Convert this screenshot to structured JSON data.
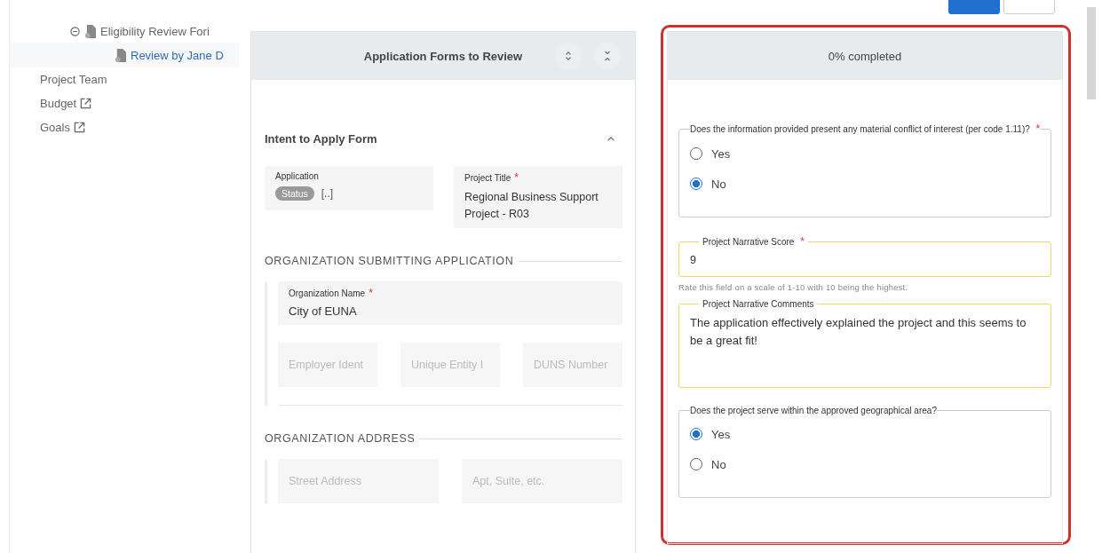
{
  "sidebar": {
    "tree": [
      {
        "label": "Eligibility Review Fori",
        "expanded": true,
        "selected": false,
        "children": [
          {
            "label": "Review by Jane D",
            "selected": true
          }
        ]
      }
    ],
    "items": [
      {
        "label": "Project Team",
        "external": false
      },
      {
        "label": "Budget",
        "external": true
      },
      {
        "label": "Goals",
        "external": true
      }
    ]
  },
  "forms_panel": {
    "title": "Application Forms to Review",
    "section": {
      "title": "Intent to Apply Form",
      "expanded": true,
      "application": {
        "label": "Application",
        "status": "Status",
        "value": "[..]"
      },
      "project_title": {
        "label": "Project Title",
        "required_mark": "*",
        "value": "Regional Business Support Project - R03"
      },
      "groups": [
        {
          "title": "ORGANIZATION SUBMITTING APPLICATION",
          "rows": [
            [
              {
                "label": "Organization Name",
                "required_mark": "*",
                "value": "City of EUNA"
              }
            ],
            [
              {
                "placeholder": "Employer Ident"
              },
              {
                "placeholder": "Unique Entity I"
              },
              {
                "placeholder": "DUNS Number"
              }
            ]
          ]
        },
        {
          "title": "ORGANIZATION ADDRESS",
          "rows": [
            [
              {
                "placeholder": "Street Address"
              },
              {
                "placeholder": "Apt, Suite, etc."
              }
            ]
          ]
        }
      ]
    }
  },
  "review_panel": {
    "progress": "0% completed",
    "questions": [
      {
        "kind": "radio",
        "label": "Does the information provided present any material conflict of interest (per code 1.11)?",
        "required_mark": "*",
        "options": [
          {
            "label": "Yes",
            "selected": false
          },
          {
            "label": "No",
            "selected": true
          }
        ]
      },
      {
        "kind": "number",
        "label": "Project Narrative Score",
        "required_mark": "*",
        "value": "9",
        "hint": "Rate this field on a scale of 1-10 with 10 being the highest."
      },
      {
        "kind": "textarea",
        "label": "Project Narrative Comments",
        "value": "The application effectively explained the project and this seems to be a great fit!"
      },
      {
        "kind": "radio",
        "label": "Does the project serve within the approved geographical area?",
        "options": [
          {
            "label": "Yes",
            "selected": true
          },
          {
            "label": "No",
            "selected": false
          }
        ]
      }
    ]
  }
}
